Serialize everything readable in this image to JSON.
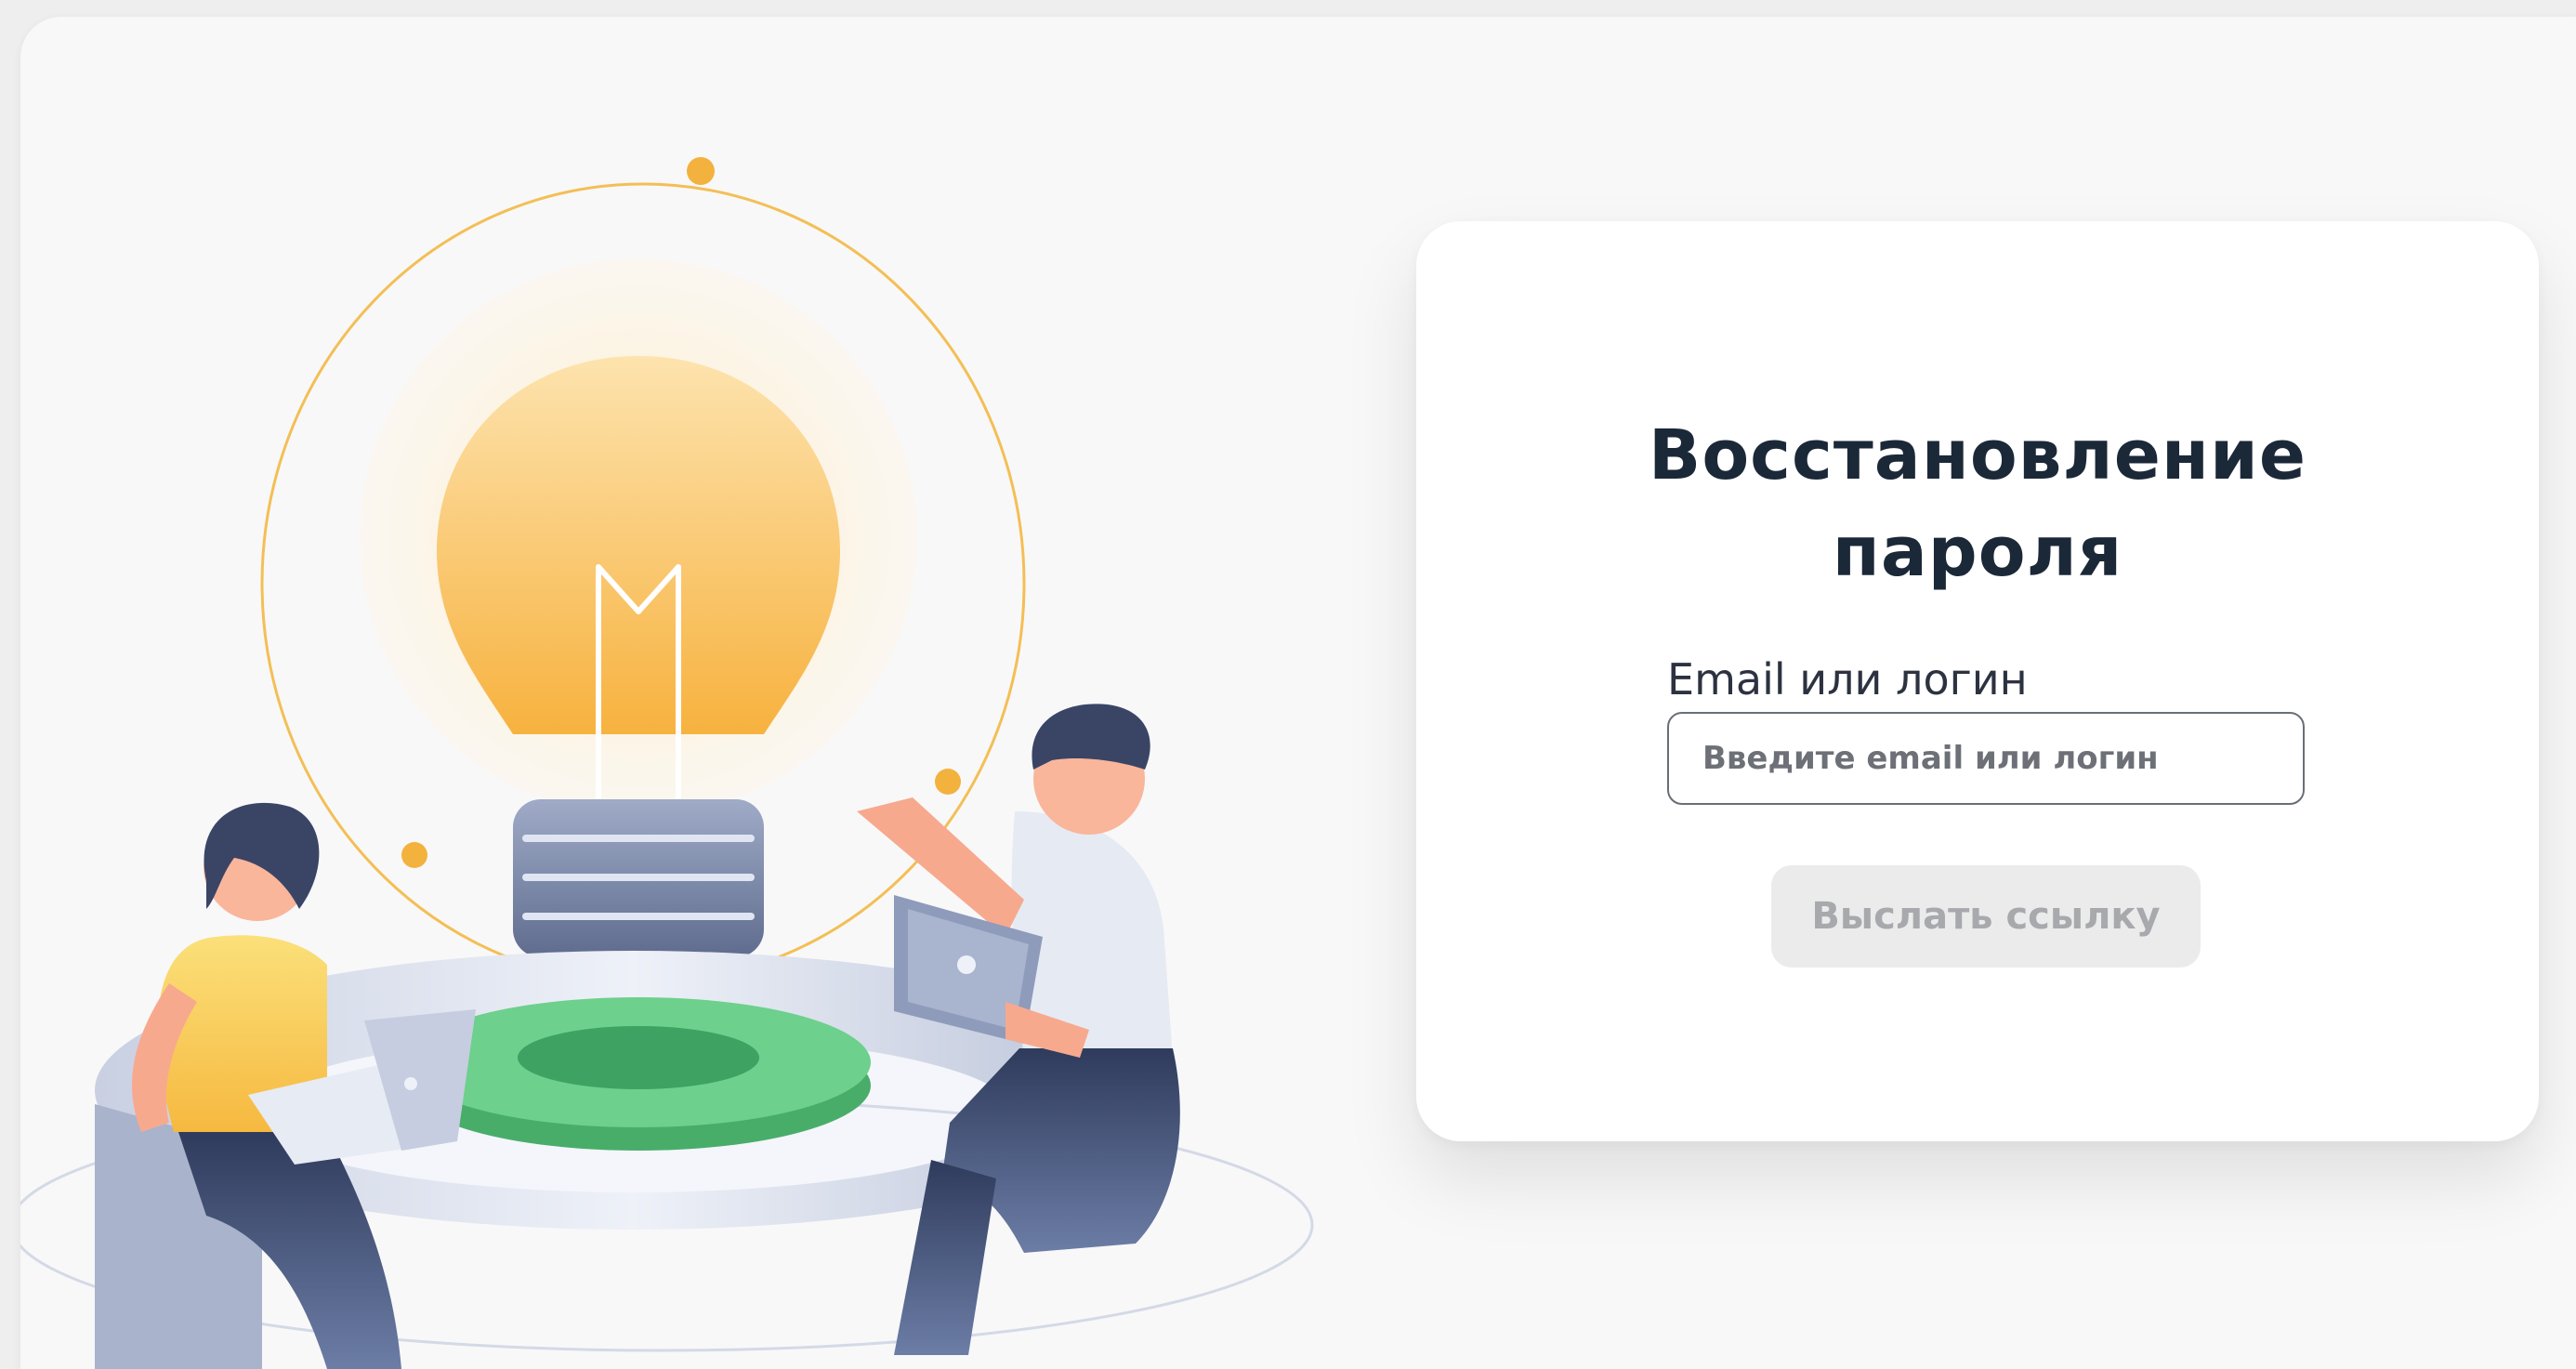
{
  "recovery_form": {
    "title_line1": "Восстановление",
    "title_line2": "пароля",
    "field_label": "Email или логин",
    "field_placeholder": "Введите email или логин",
    "field_value": "",
    "submit_label": "Выслать ссылку",
    "submit_state": "disabled"
  },
  "colors": {
    "page_background": "#f8f8f9",
    "card_background": "#ffffff",
    "title_text": "#1b2838",
    "input_border": "#6a6e75",
    "button_disabled_bg": "#ebebec",
    "button_disabled_text": "#a8a9ad",
    "accent_yellow": "#f5b23a",
    "accent_green": "#56c278"
  },
  "illustration": {
    "subject": "lightbulb-with-two-people-on-laptops",
    "icons": [
      "lightbulb-icon",
      "laptop-icon",
      "person-figure"
    ]
  }
}
